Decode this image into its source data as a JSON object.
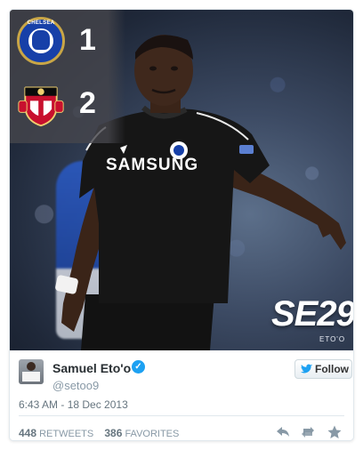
{
  "scoreboard": {
    "home_team_crest": "chelsea-crest",
    "home_score": "1",
    "away_team_crest": "sunderland-crest",
    "away_score": "2"
  },
  "photo_branding": {
    "logo": "SE29",
    "logo_sub": "ETO'O",
    "shirt_sponsor": "SAMSUNG"
  },
  "tweet": {
    "author_name": "Samuel Eto'o",
    "handle": "@setoo9",
    "verified_icon": "verified-icon",
    "follow_label": "Follow",
    "timestamp": "6:43 AM - 18 Dec 2013",
    "retweet_count": "448",
    "retweet_label": "RETWEETS",
    "favorite_count": "386",
    "favorite_label": "FAVORITES"
  },
  "colors": {
    "accent": "#1da1f2",
    "muted": "#8899a6",
    "text": "#292f33"
  }
}
